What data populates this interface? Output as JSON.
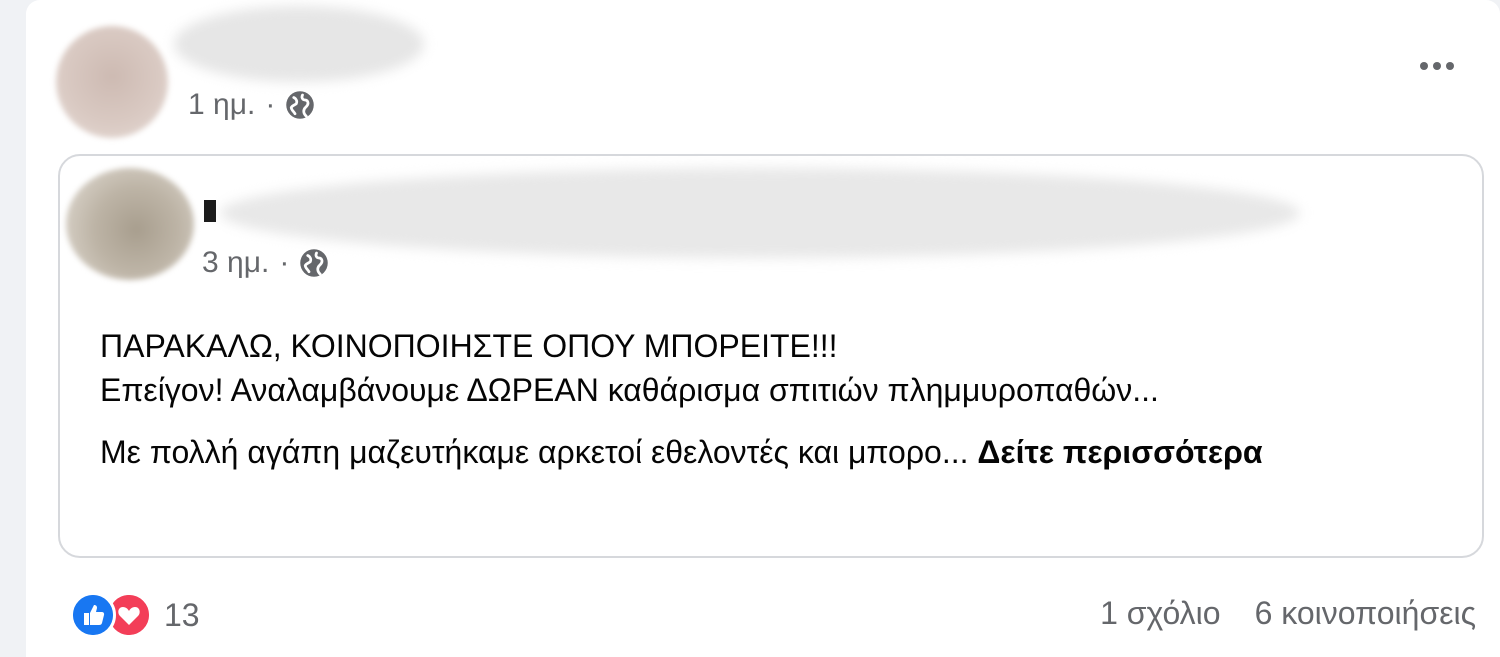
{
  "post": {
    "time": "1 ημ.",
    "separator": "·",
    "privacy_icon": "globe-icon",
    "more_icon": "more-options-icon"
  },
  "shared": {
    "name_initial": "",
    "time": "3 ημ.",
    "separator": "·",
    "privacy_icon": "globe-icon",
    "body": {
      "line1": "ΠΑΡΑΚΑΛΩ, ΚΟΙΝΟΠΟΙΗΣΤΕ ΟΠΟΥ ΜΠΟΡΕΙΤΕ!!!",
      "line2": "Επείγον! Αναλαμβάνουμε ΔΩΡΕΑΝ καθάρισμα σπιτιών πλημμυροπαθών...",
      "line3": "Με πολλή αγάπη μαζευτήκαμε αρκετοί εθελοντές και μπορο... ",
      "see_more": "Δείτε περισσότερα"
    }
  },
  "footer": {
    "reaction_icons": [
      "like-icon",
      "love-icon"
    ],
    "reaction_count": "13",
    "comments": "1 σχόλιο",
    "shares": "6 κοινοποιήσεις"
  },
  "colors": {
    "like": "#1877f2",
    "love": "#f33e58",
    "secondary_text": "#65676b",
    "border": "#d6d8dc"
  }
}
